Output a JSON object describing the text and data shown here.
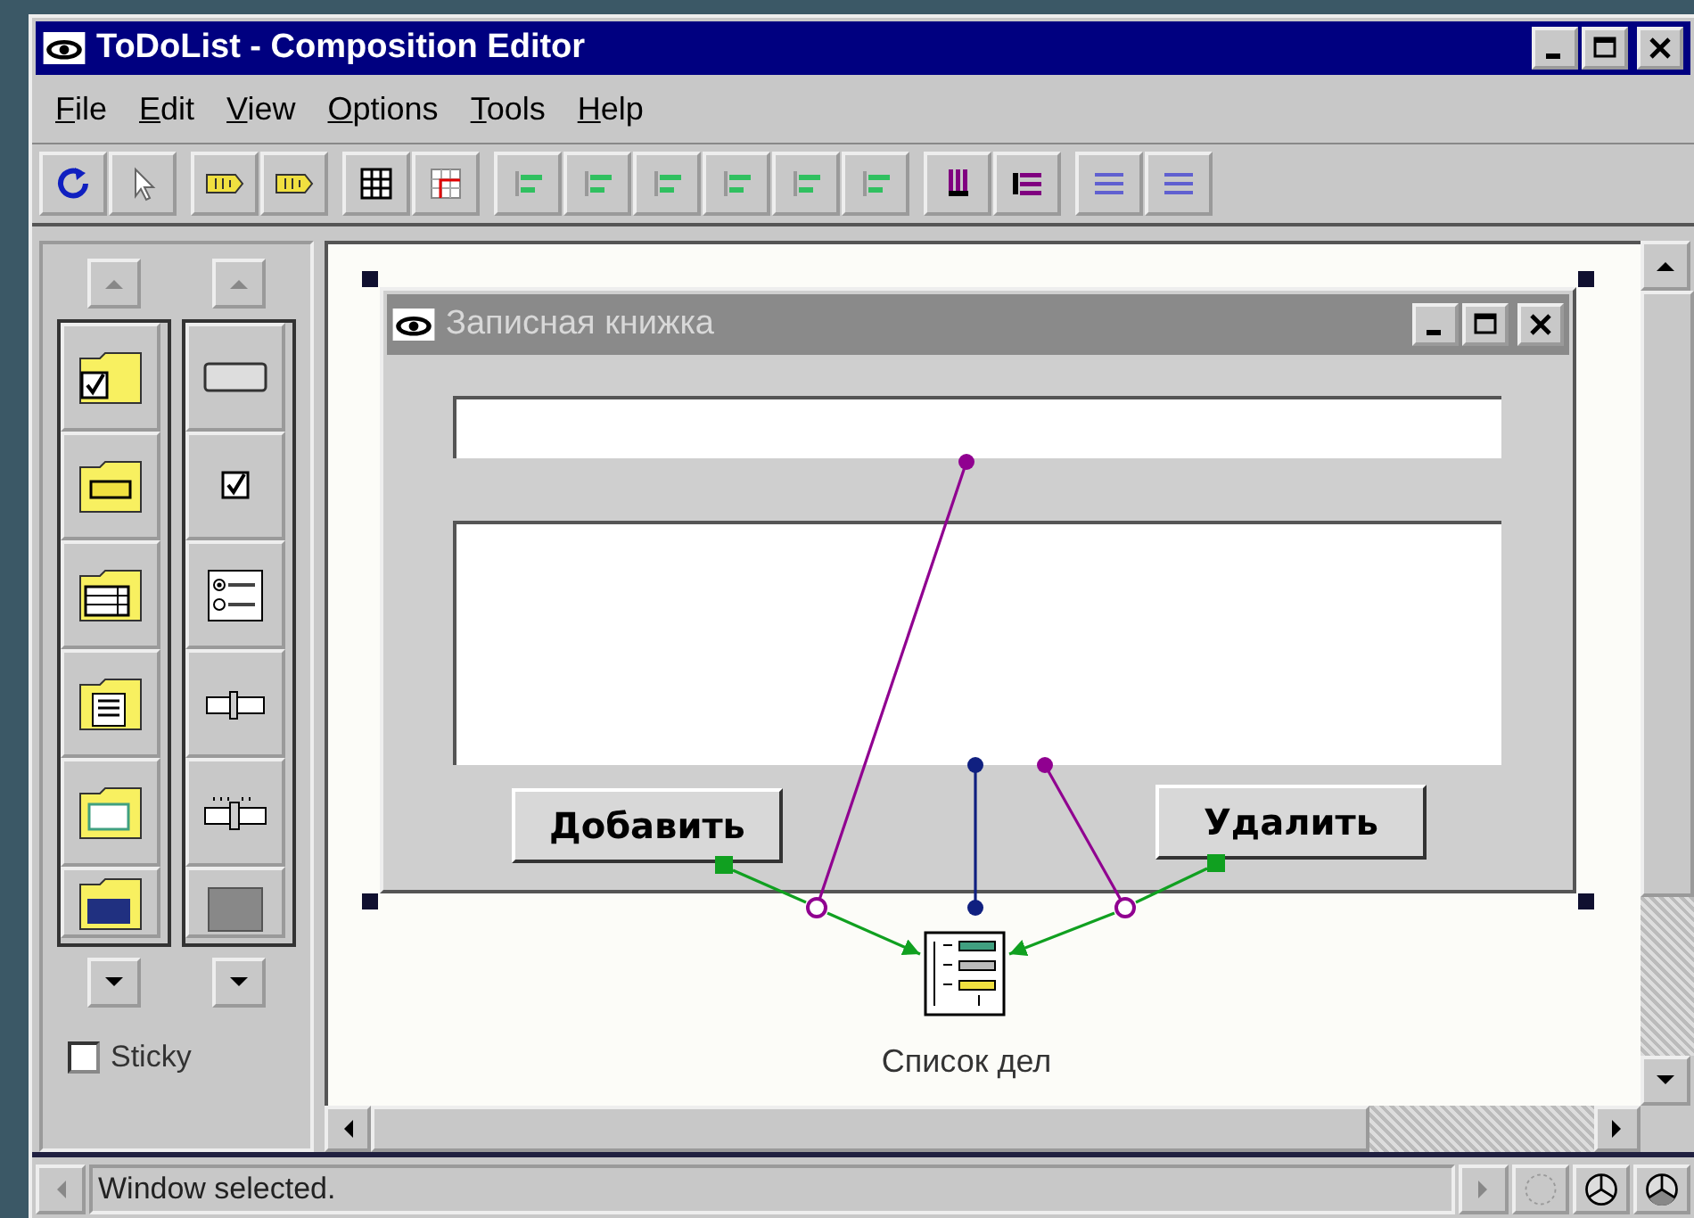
{
  "window": {
    "title": "ToDoList - Composition Editor"
  },
  "menu": [
    "File",
    "Edit",
    "View",
    "Options",
    "Tools",
    "Help"
  ],
  "palette": {
    "sticky": {
      "label": "Sticky",
      "checked": false
    }
  },
  "composition": {
    "window_title": "Записная книжка",
    "buttons": [
      "Добавить",
      "Удалить"
    ],
    "nonvisual_part": {
      "label": "Список дел"
    }
  },
  "status_bar": {
    "text": "Window selected."
  }
}
